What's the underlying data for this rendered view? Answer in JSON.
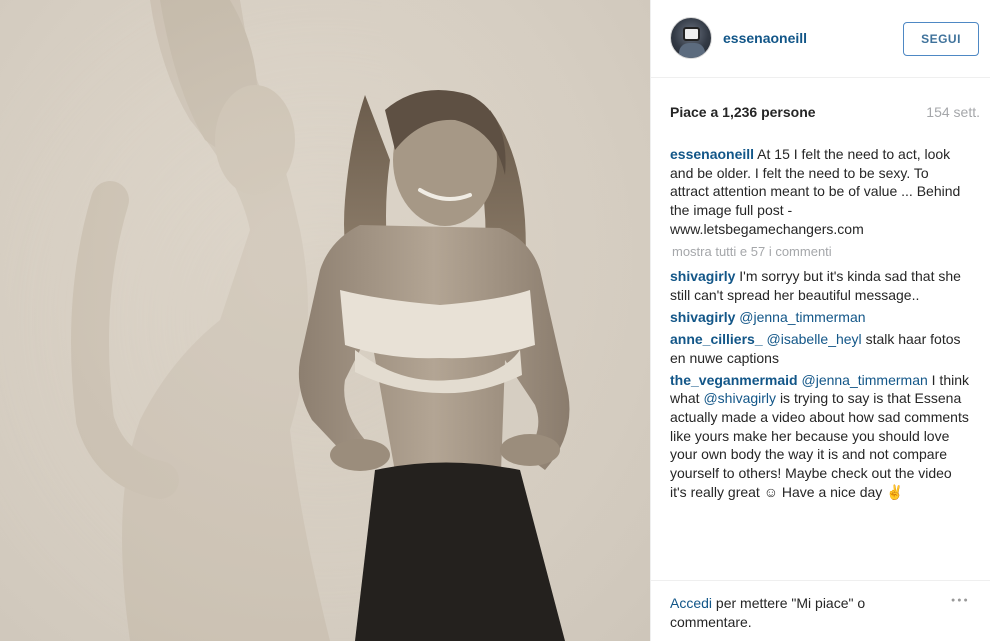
{
  "post": {
    "username": "essenaoneill",
    "follow_label": "SEGUI",
    "likes_text": "Piace a 1,236 persone",
    "age": "154 sett.",
    "caption": {
      "user": "essenaoneill",
      "text": "At 15 I felt the need to act, look and be older. I felt the need to be sexy. To attract attention meant to be of value ... Behind the image full post - www.letsbegamechangers.com"
    },
    "view_all_comments": "mostra tutti e 57 i commenti",
    "comments": [
      {
        "user": "shivagirly",
        "mention": "",
        "text": "I'm sorryy but it's kinda sad that she still can't spread her beautiful message.."
      },
      {
        "user": "shivagirly",
        "mention": "@jenna_timmerman",
        "text": ""
      },
      {
        "user": "anne_cilliers_",
        "mention": "@isabelle_heyl",
        "text": "stalk haar fotos en nuwe captions"
      },
      {
        "user": "the_veganmermaid",
        "mention": "@jenna_timmerman",
        "text_before": "I think what",
        "inline_mention": "@shivagirly",
        "text_after": "is trying to say is that Essena actually made a video about how sad comments like yours make her because you should love your own body the way it is and not compare yourself to others! Maybe check out the video it's really great ☺ Have a nice day ✌"
      }
    ],
    "footer": {
      "login_link": "Accedi",
      "login_text": "per mettere \"Mi piace\" o commentare.",
      "more_icon": "ellipsis-icon"
    }
  }
}
